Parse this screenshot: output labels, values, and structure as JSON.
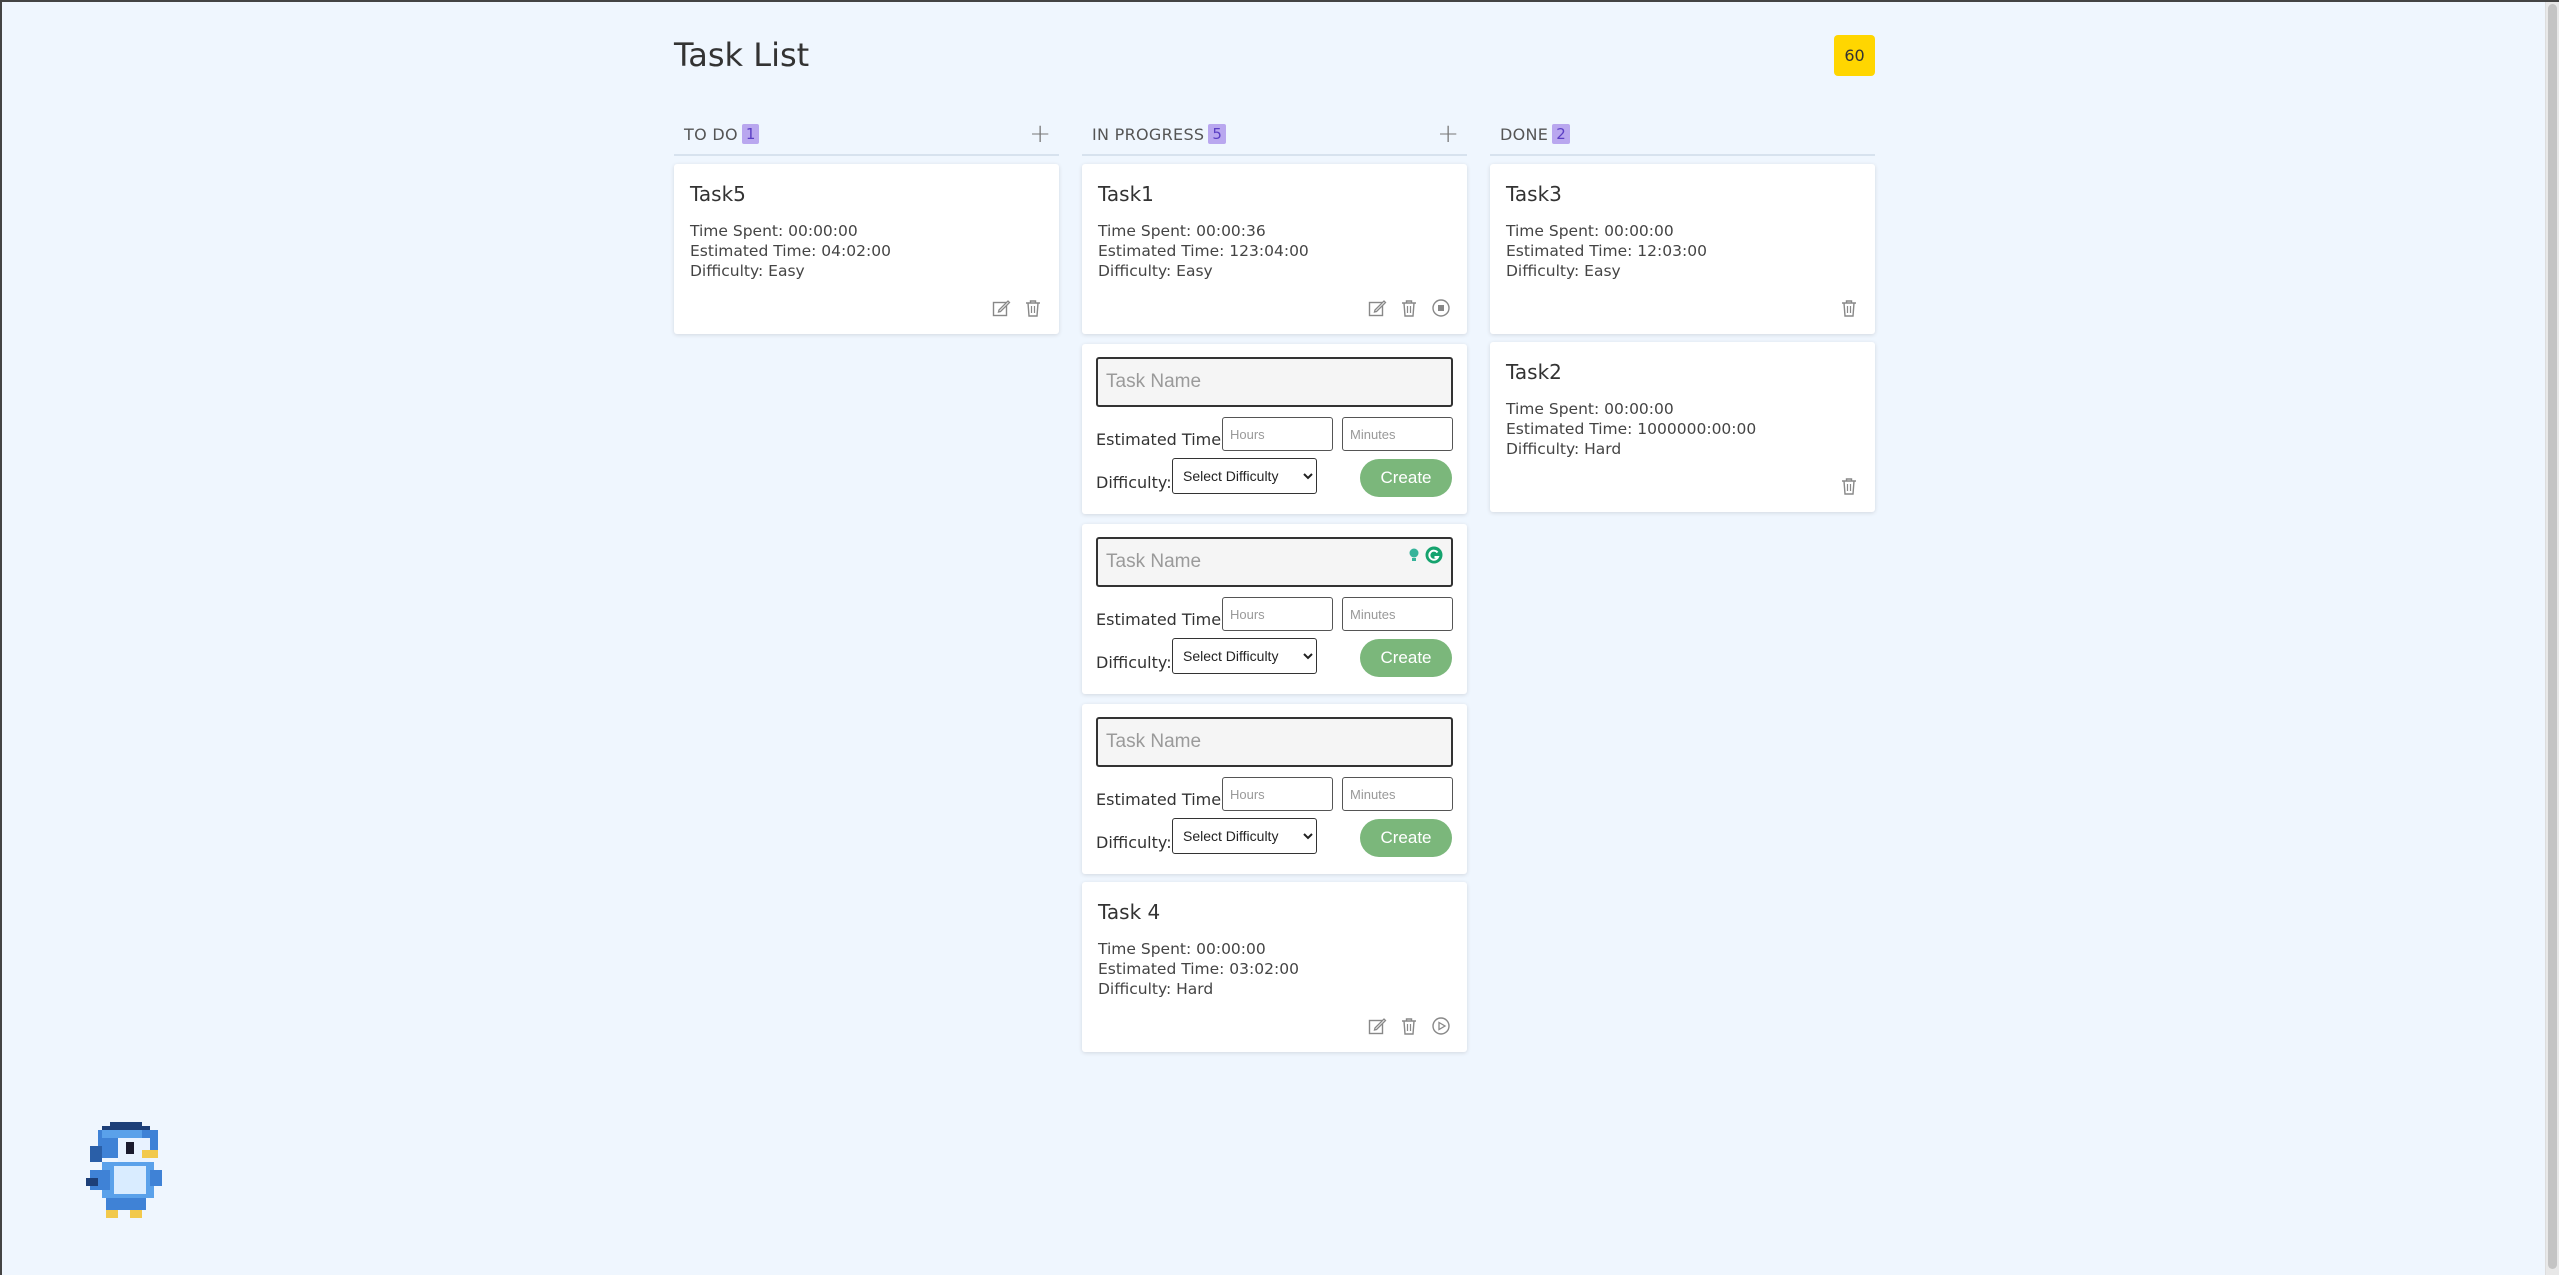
{
  "page": {
    "title": "Task List",
    "counter": "60"
  },
  "columns": {
    "todo": {
      "title": "TO DO",
      "count": "1",
      "add_symbol": "+"
    },
    "progress": {
      "title": "IN PROGRESS",
      "count": "5",
      "add_symbol": "+"
    },
    "done": {
      "title": "DONE",
      "count": "2",
      "add_symbol": "+"
    }
  },
  "tasks": {
    "task5": {
      "name": "Task5",
      "time_spent": "Time Spent: 00:00:00",
      "estimated": "Estimated Time: 04:02:00",
      "difficulty": "Difficulty: Easy"
    },
    "task1": {
      "name": "Task1",
      "time_spent": "Time Spent: 00:00:36",
      "estimated": "Estimated Time: 123:04:00",
      "difficulty": "Difficulty: Easy"
    },
    "task4": {
      "name": "Task 4",
      "time_spent": "Time Spent: 00:00:00",
      "estimated": "Estimated Time: 03:02:00",
      "difficulty": "Difficulty: Hard"
    },
    "task3": {
      "name": "Task3",
      "time_spent": "Time Spent: 00:00:00",
      "estimated": "Estimated Time: 12:03:00",
      "difficulty": "Difficulty: Easy"
    },
    "task2": {
      "name": "Task2",
      "time_spent": "Time Spent: 00:00:00",
      "estimated": "Estimated Time: 1000000:00:00",
      "difficulty": "Difficulty: Hard"
    }
  },
  "form": {
    "task_name_placeholder": "Task Name",
    "estimated_label": "Estimated Time:",
    "hours_placeholder": "Hours",
    "minutes_placeholder": "Minutes",
    "difficulty_label": "Difficulty:",
    "difficulty_selected": "Select Difficulty",
    "create_label": "Create"
  },
  "icons": {
    "edit": "edit-icon",
    "delete": "trash-icon",
    "stop": "stop-icon",
    "play": "play-icon",
    "add": "plus-icon"
  },
  "colors": {
    "background": "#eff6fe",
    "counter_badge": "#ffd600",
    "count_badge": "#b9a7ef",
    "create_button": "#7bb77b"
  }
}
